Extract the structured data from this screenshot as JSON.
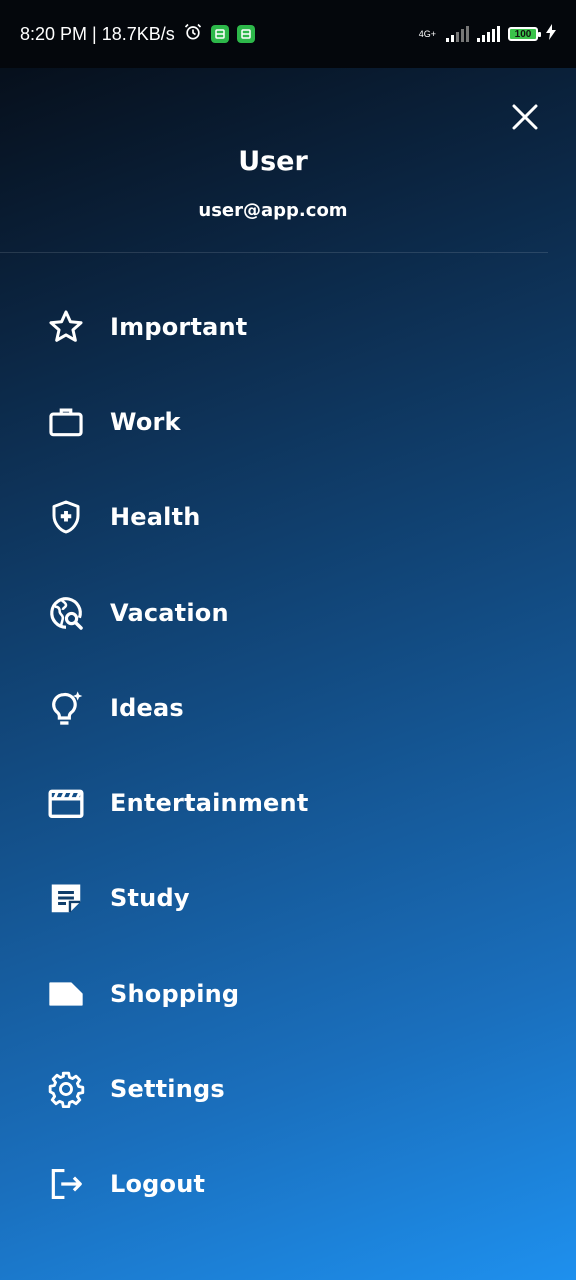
{
  "status_bar": {
    "time_speed": "8:20 PM | 18.7KB/s",
    "network_type": "4G+",
    "battery": "100"
  },
  "profile": {
    "name": "User",
    "email": "user@app.com"
  },
  "menu": {
    "items": [
      {
        "label": "Important",
        "icon": "star-icon"
      },
      {
        "label": "Work",
        "icon": "briefcase-icon"
      },
      {
        "label": "Health",
        "icon": "shield-plus-icon"
      },
      {
        "label": "Vacation",
        "icon": "globe-search-icon"
      },
      {
        "label": "Ideas",
        "icon": "lightbulb-icon"
      },
      {
        "label": "Entertainment",
        "icon": "clapperboard-icon"
      },
      {
        "label": "Study",
        "icon": "note-icon"
      },
      {
        "label": "Shopping",
        "icon": "label-tag-icon"
      },
      {
        "label": "Settings",
        "icon": "gear-icon"
      },
      {
        "label": "Logout",
        "icon": "logout-icon"
      }
    ]
  }
}
